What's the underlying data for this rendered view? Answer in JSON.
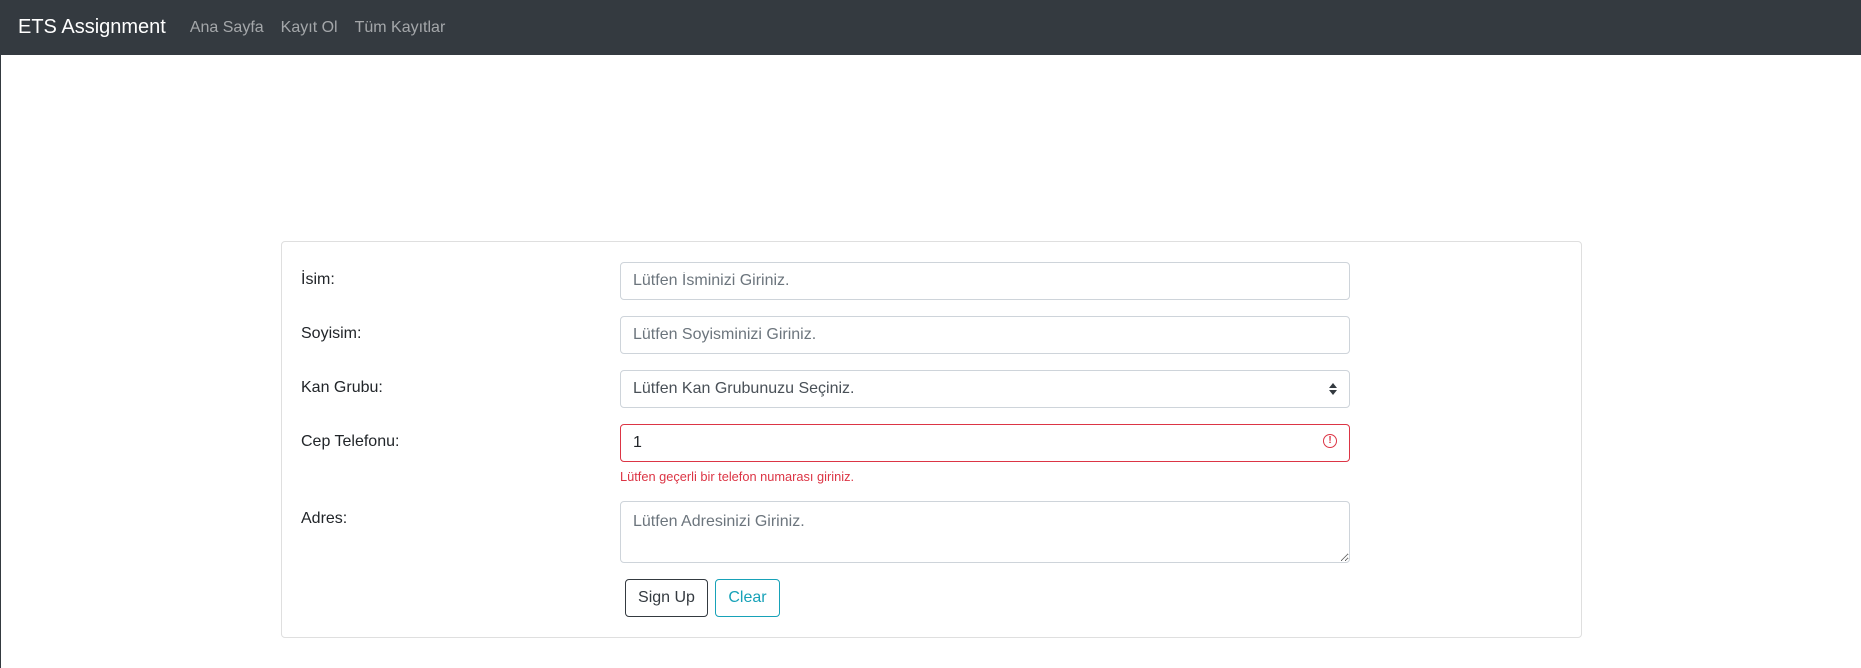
{
  "navbar": {
    "brand": "ETS Assignment",
    "links": [
      "Ana Sayfa",
      "Kayıt Ol",
      "Tüm Kayıtlar"
    ]
  },
  "form": {
    "name": {
      "label": "İsim:",
      "placeholder": "Lütfen İsminizi Giriniz.",
      "value": ""
    },
    "surname": {
      "label": "Soyisim:",
      "placeholder": "Lütfen Soyisminizi Giriniz.",
      "value": ""
    },
    "blood_group": {
      "label": "Kan Grubu:",
      "selected": "Lütfen Kan Grubunuzu Seçiniz."
    },
    "phone": {
      "label": "Cep Telefonu:",
      "value": "1",
      "error": "Lütfen geçerli bir telefon numarası giriniz.",
      "error_icon": "alert-circle-icon"
    },
    "address": {
      "label": "Adres:",
      "placeholder": "Lütfen Adresinizi Giriniz.",
      "value": ""
    },
    "buttons": {
      "signup": "Sign Up",
      "clear": "Clear"
    }
  },
  "colors": {
    "navbar_bg": "#343a40",
    "invalid": "#dc3545",
    "info": "#17a2b8"
  }
}
